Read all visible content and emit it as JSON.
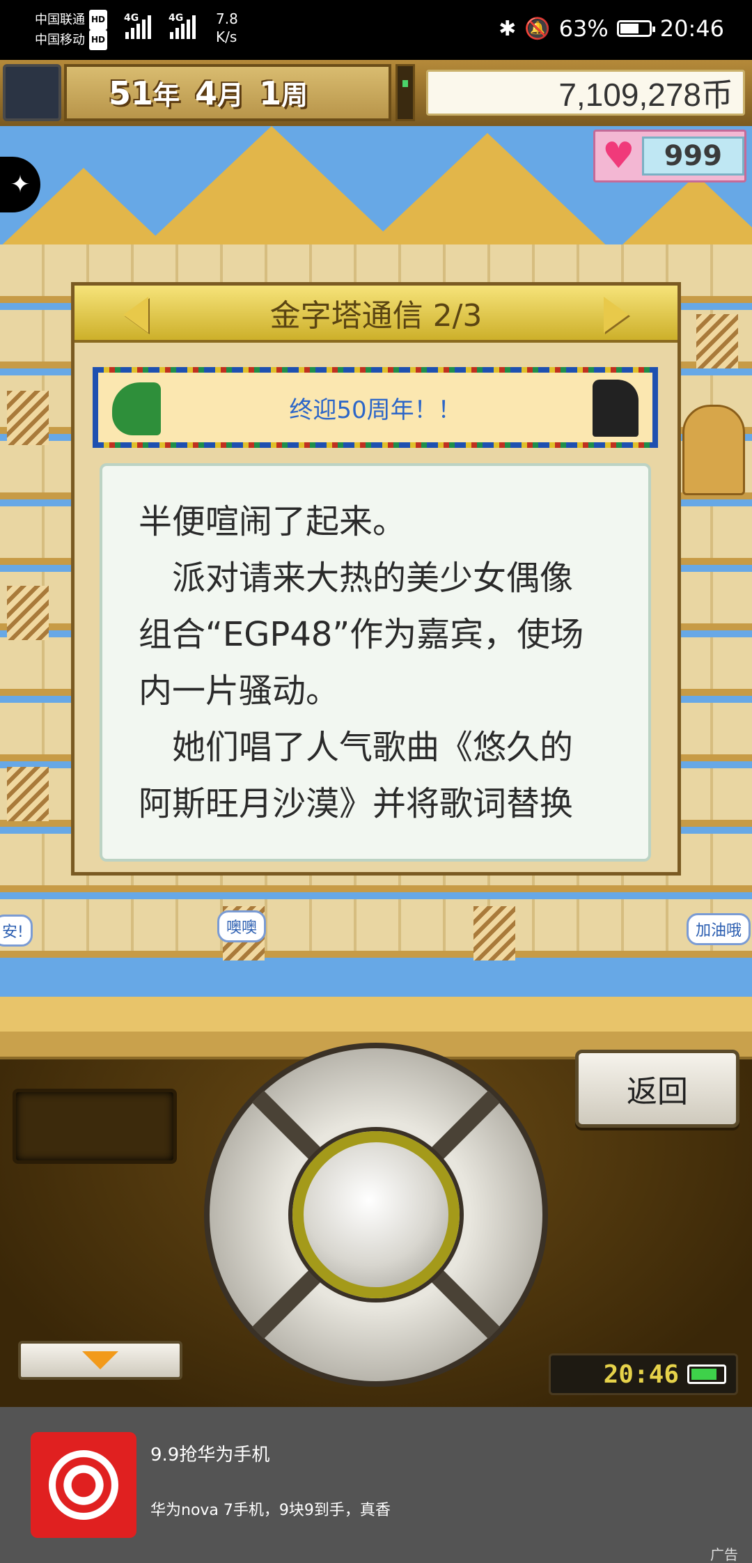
{
  "status_bar": {
    "carrier1": "中国联通",
    "carrier2": "中国移动",
    "hd": "HD",
    "network": "4G",
    "net_speed_value": "7.8",
    "net_speed_unit": "K/s",
    "battery_percent": "63%",
    "time": "20:46"
  },
  "game_header": {
    "year": "51",
    "year_unit": "年",
    "month": "4",
    "month_unit": "月",
    "week": "1",
    "week_unit": "周",
    "money": "7,109,278币",
    "hearts": "999"
  },
  "dialog": {
    "title": "金字塔通信 2/3",
    "banner": "终迎50周年！！",
    "message_lines": [
      "半便喧闹了起来。",
      "　派对请来大热的美少女偶像",
      "组合“EGP48”作为嘉宾，使场",
      "内一片骚动。",
      "　她们唱了人气歌曲《悠久的",
      "阿斯旺月沙漠》并将歌词替换"
    ]
  },
  "speech_bubbles": {
    "left": "安!",
    "middle": "噢噢",
    "right": "加油哦"
  },
  "controls": {
    "back_label": "返回",
    "game_clock": "20:46"
  },
  "ad": {
    "title": "9.9抢华为手机",
    "description": "华为nova 7手机，9块9到手，真香",
    "tag": "广告"
  }
}
